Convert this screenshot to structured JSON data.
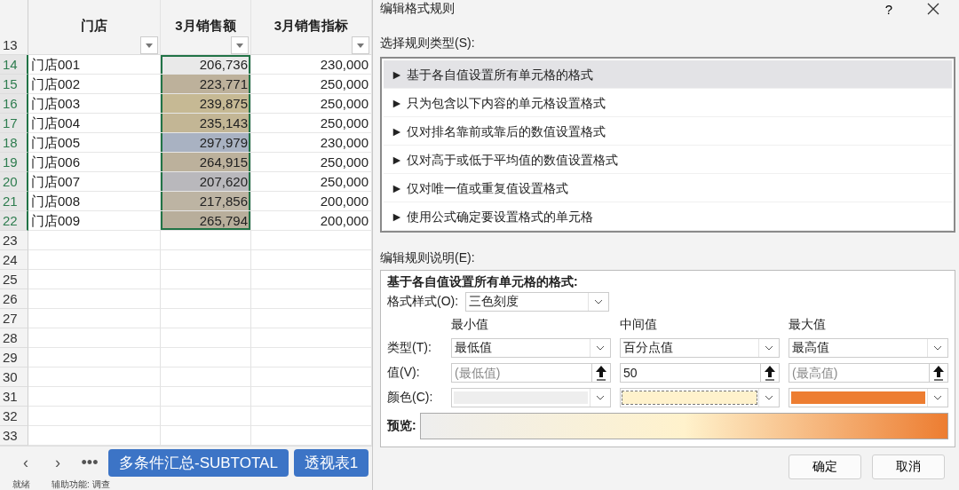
{
  "sheet": {
    "header_row": "13",
    "columns": [
      {
        "label": "门店"
      },
      {
        "label": "3月销售额"
      },
      {
        "label": "3月销售指标"
      }
    ],
    "rows": [
      {
        "num": "14",
        "store": "门店001",
        "sales": "206,736",
        "color": "#e9e9e9",
        "target": "230,000"
      },
      {
        "num": "15",
        "store": "门店002",
        "sales": "223,771",
        "color": "#bdb19b",
        "target": "250,000"
      },
      {
        "num": "16",
        "store": "门店003",
        "sales": "239,875",
        "color": "#c6b994",
        "target": "250,000"
      },
      {
        "num": "17",
        "store": "门店004",
        "sales": "235,143",
        "color": "#c3b695",
        "target": "250,000"
      },
      {
        "num": "18",
        "store": "门店005",
        "sales": "297,979",
        "color": "#a9b2c2",
        "target": "230,000"
      },
      {
        "num": "19",
        "store": "门店006",
        "sales": "264,915",
        "color": "#bcb19c",
        "target": "250,000"
      },
      {
        "num": "20",
        "store": "门店007",
        "sales": "207,620",
        "color": "#b9b8bc",
        "target": "250,000"
      },
      {
        "num": "21",
        "store": "门店008",
        "sales": "217,856",
        "color": "#bdb4a3",
        "target": "200,000"
      },
      {
        "num": "22",
        "store": "门店009",
        "sales": "265,794",
        "color": "#b8ae9b",
        "target": "200,000"
      }
    ],
    "empty_rows": [
      "23",
      "24",
      "25",
      "26",
      "27",
      "28",
      "29",
      "30",
      "31",
      "32",
      "33"
    ]
  },
  "sheet_tabs": {
    "nav": [
      "‹",
      "›",
      "•••"
    ],
    "tabs": [
      {
        "label": "多条件汇总-SUBTOTAL",
        "selected": true
      },
      {
        "label": "透视表1",
        "selected": true
      }
    ]
  },
  "status_bar": [
    "就绪",
    "辅助功能: 调查"
  ],
  "dialog": {
    "title": "编辑格式规则",
    "help": "?",
    "rule_type_label": "选择规则类型(S):",
    "rule_types": [
      {
        "label": "► 基于各自值设置所有单元格的格式",
        "selected": true
      },
      {
        "label": "► 只为包含以下内容的单元格设置格式",
        "selected": false
      },
      {
        "label": "► 仅对排名靠前或靠后的数值设置格式",
        "selected": false
      },
      {
        "label": "► 仅对高于或低于平均值的数值设置格式",
        "selected": false
      },
      {
        "label": "► 仅对唯一值或重复值设置格式",
        "selected": false
      },
      {
        "label": "► 使用公式确定要设置格式的单元格",
        "selected": false
      }
    ],
    "description_label": "编辑规则说明(E):",
    "description_title": "基于各自值设置所有单元格的格式:",
    "style_label": "格式样式(O):",
    "style_value": "三色刻度",
    "row_labels": [
      "类型(T):",
      "值(V):",
      "颜色(C):"
    ],
    "points": [
      {
        "heading": "最小值",
        "type": "最低值",
        "placeholder": "(最低值)",
        "color": "#eeeeee"
      },
      {
        "heading": "中间值",
        "type": "百分点值",
        "value": "50",
        "color": "#fff2cc"
      },
      {
        "heading": "最大值",
        "type": "最高值",
        "placeholder": "(最高值)",
        "color": "#ed7d31"
      }
    ],
    "preview_label": "预览:",
    "buttons": [
      "确定",
      "取消"
    ]
  }
}
